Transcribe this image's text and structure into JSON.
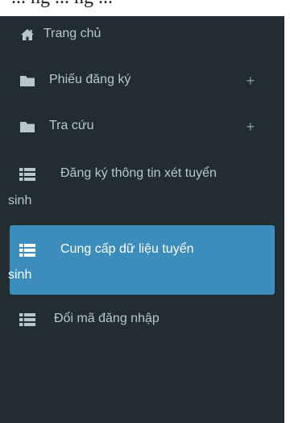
{
  "page": {
    "cut_text": "... ng ... ng ..."
  },
  "sidebar": {
    "items": [
      {
        "label": "Trang chủ",
        "icon": "home-icon",
        "expandable": false,
        "active": false
      },
      {
        "label": "Phiếu đăng ký",
        "icon": "folder-icon",
        "expandable": true,
        "expand_glyph": "+",
        "active": false
      },
      {
        "label": "Tra cứu",
        "icon": "folder-icon",
        "expandable": true,
        "expand_glyph": "+",
        "active": false
      },
      {
        "label_line1": "Đăng ký thông tin xét tuyển",
        "label_line2": "sinh",
        "icon": "list-icon",
        "expandable": false,
        "active": false
      },
      {
        "label_line1": "Cung cấp dữ liệu tuyển",
        "label_line2": "sinh",
        "icon": "list-icon",
        "expandable": false,
        "active": true
      },
      {
        "label": "Đổi mã đăng nhập",
        "icon": "list-icon",
        "expandable": false,
        "active": false
      }
    ]
  },
  "colors": {
    "sidebar_bg": "#222d32",
    "text": "#b8c7ce",
    "active_bg": "#3c8dbc",
    "active_text": "#ffffff"
  }
}
